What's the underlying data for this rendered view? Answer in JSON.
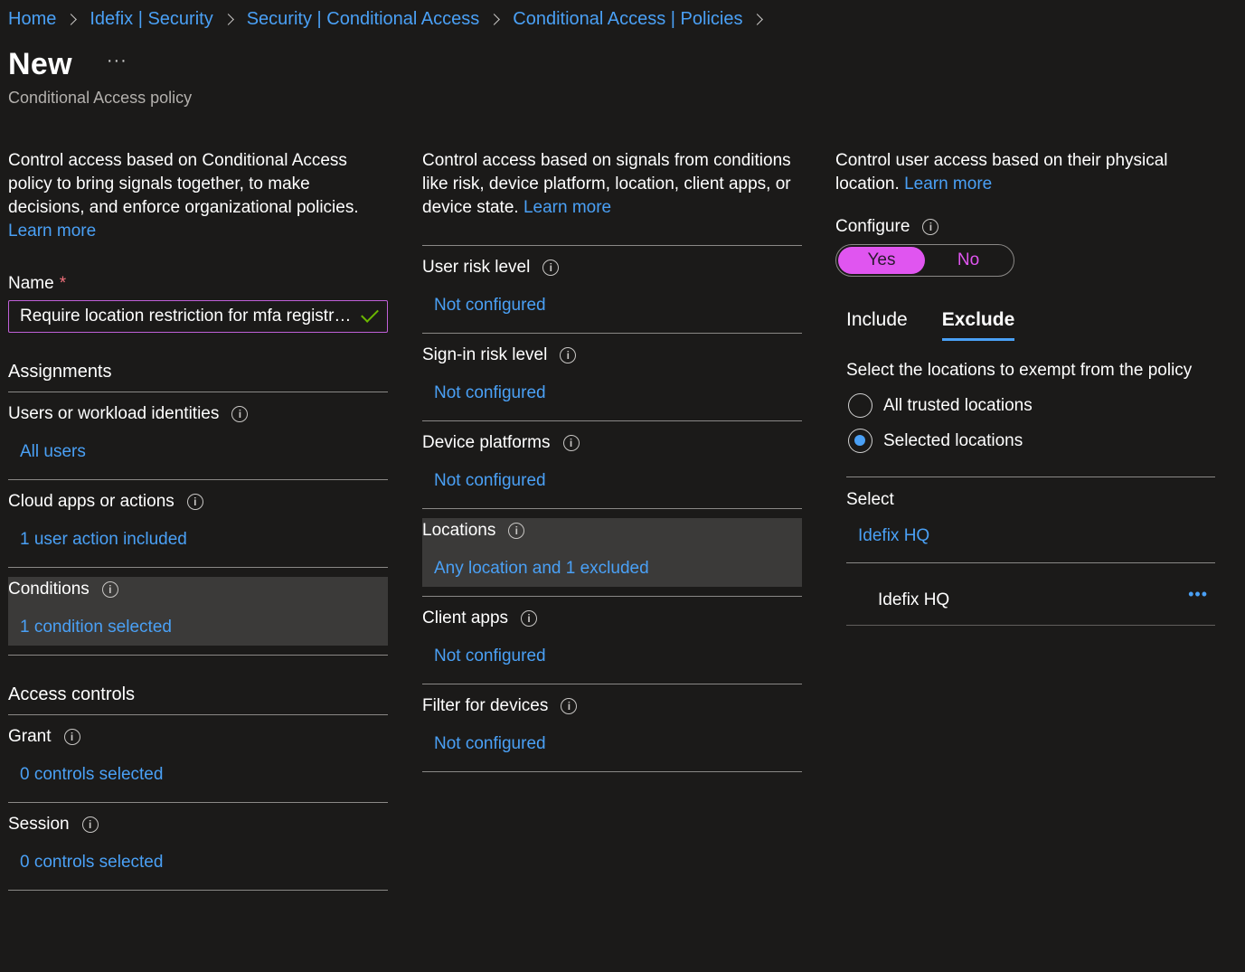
{
  "breadcrumb": [
    "Home",
    "Idefix | Security",
    "Security | Conditional Access",
    "Conditional Access | Policies"
  ],
  "header": {
    "title": "New",
    "more": "···",
    "subtitle": "Conditional Access policy"
  },
  "left": {
    "description": "Control access based on Conditional Access policy to bring signals together, to make decisions, and enforce organizational policies.",
    "learn_more": "Learn more",
    "name_label": "Name",
    "required_mark": "*",
    "name_value": "Require location restriction for mfa registration",
    "assignments_heading": "Assignments",
    "assignments": [
      {
        "label": "Users or workload identities",
        "value": "All users"
      },
      {
        "label": "Cloud apps or actions",
        "value": "1 user action included"
      },
      {
        "label": "Conditions",
        "value": "1 condition selected"
      }
    ],
    "access_heading": "Access controls",
    "access": [
      {
        "label": "Grant",
        "value": "0 controls selected"
      },
      {
        "label": "Session",
        "value": "0 controls selected"
      }
    ]
  },
  "middle": {
    "description": "Control access based on signals from conditions like risk, device platform, location, client apps, or device state.",
    "learn_more": "Learn more",
    "conditions": [
      {
        "label": "User risk level",
        "value": "Not configured"
      },
      {
        "label": "Sign-in risk level",
        "value": "Not configured"
      },
      {
        "label": "Device platforms",
        "value": "Not configured"
      },
      {
        "label": "Locations",
        "value": "Any location and 1 excluded"
      },
      {
        "label": "Client apps",
        "value": "Not configured"
      },
      {
        "label": "Filter for devices",
        "value": "Not configured"
      }
    ]
  },
  "right": {
    "description": "Control user access based on their physical location.",
    "learn_more": "Learn more",
    "configure_label": "Configure",
    "toggle_yes": "Yes",
    "toggle_no": "No",
    "tab_include": "Include",
    "tab_exclude": "Exclude",
    "exempt_text": "Select the locations to exempt from the policy",
    "radio_all": "All trusted locations",
    "radio_selected": "Selected locations",
    "select_label": "Select",
    "select_value": "Idefix HQ",
    "location_item": "Idefix HQ",
    "location_more": "•••"
  },
  "colors": {
    "accent_link": "#4aa0f5",
    "toggle_on": "#e055f0",
    "highlight": "#3b3a39"
  }
}
